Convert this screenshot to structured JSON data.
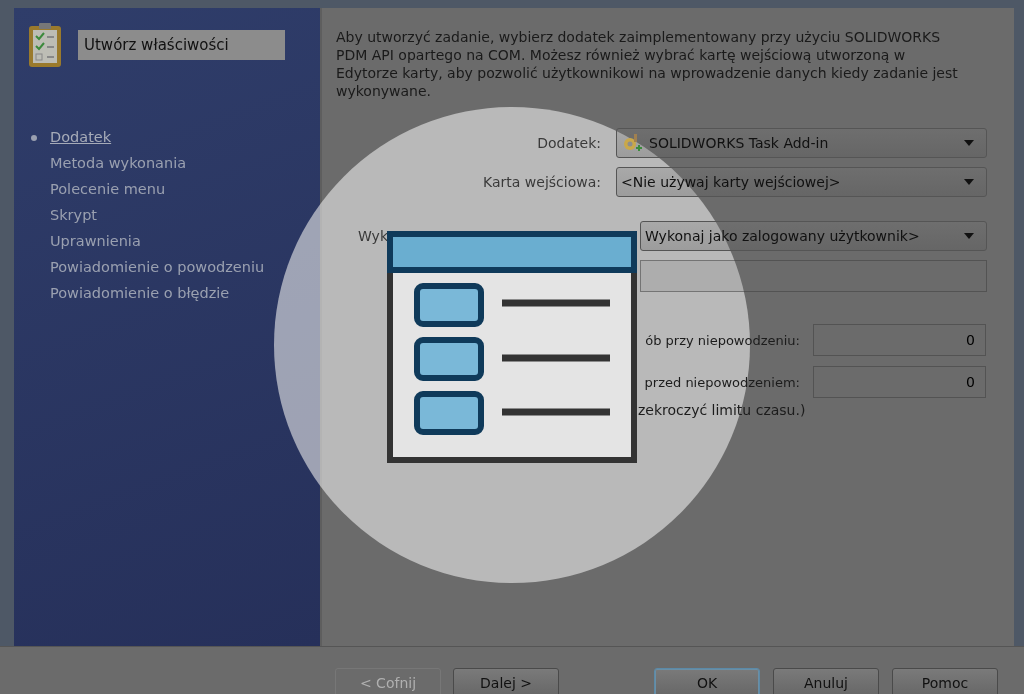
{
  "sidebar": {
    "title": "Utwórz właściwości",
    "steps": [
      {
        "label": "Dodatek",
        "selected": true
      },
      {
        "label": "Metoda wykonania",
        "selected": false
      },
      {
        "label": "Polecenie menu",
        "selected": false
      },
      {
        "label": "Skrypt",
        "selected": false
      },
      {
        "label": "Uprawnienia",
        "selected": false
      },
      {
        "label": "Powiadomienie o powodzeniu",
        "selected": false
      },
      {
        "label": "Powiadomienie o błędzie",
        "selected": false
      }
    ]
  },
  "description": "Aby utworzyć zadanie, wybierz dodatek zaimplementowany przy użyciu SOLIDWORKS PDM API opartego na COM. Możesz również wybrać kartę wejściową utworzoną w Edytorze karty, aby pozwolić użytkownikowi na wprowadzenie danych kiedy zadanie jest wykonywane.",
  "fields": [
    {
      "kind": "combo",
      "label": "Dodatek:",
      "value": "SOLIDWORKS Task Add-in",
      "icon": true
    },
    {
      "kind": "combo",
      "label": "Karta wejściowa:",
      "value": "<Nie używaj karty wejściowej>",
      "icon": false
    },
    {
      "kind": "combo-partial",
      "label": "Wyk",
      "value": "Wykonaj jako zalogowany użytkownik>",
      "icon": false
    },
    {
      "kind": "text"
    },
    {
      "kind": "number",
      "label": "ób przy niepowodzeniu:",
      "value": "0"
    },
    {
      "kind": "number",
      "label": "przed niepowodzeniem:",
      "value": "0"
    },
    {
      "kind": "note",
      "label": "zekroczyć limitu czasu.)"
    }
  ],
  "buttons": [
    {
      "label": "< Cofnij",
      "disabled": true,
      "focused": false
    },
    {
      "label": "Dalej >",
      "disabled": false,
      "focused": false
    },
    {
      "label": "OK",
      "disabled": false,
      "focused": true
    },
    {
      "label": "Anuluj",
      "disabled": false,
      "focused": false
    },
    {
      "label": "Pomoc",
      "disabled": false,
      "focused": false
    }
  ]
}
